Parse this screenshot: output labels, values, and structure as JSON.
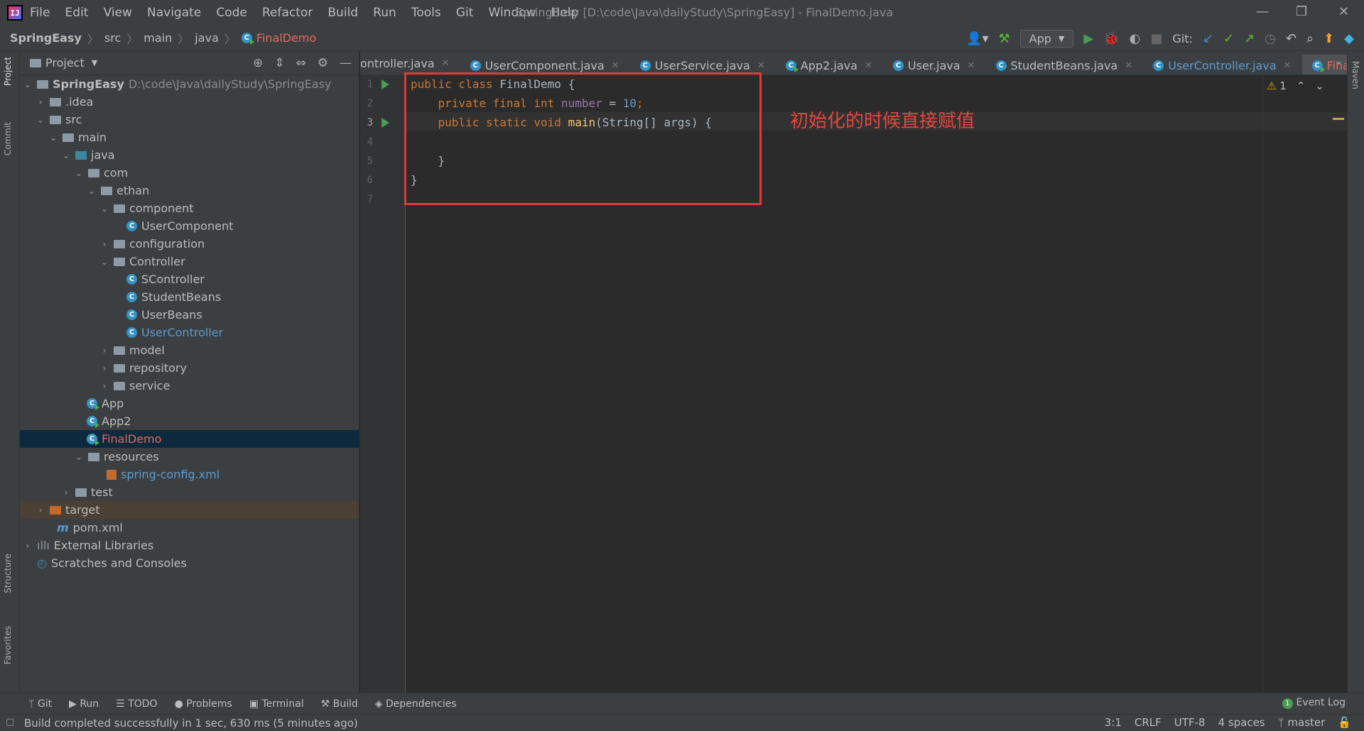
{
  "window": {
    "logo": "IJ",
    "menu": [
      "File",
      "Edit",
      "View",
      "Navigate",
      "Code",
      "Refactor",
      "Build",
      "Run",
      "Tools",
      "Git",
      "Window",
      "Help"
    ],
    "title": "SpringEasy [D:\\code\\Java\\dailyStudy\\SpringEasy] - FinalDemo.java"
  },
  "breadcrumb": [
    "SpringEasy",
    "src",
    "main",
    "java",
    "FinalDemo"
  ],
  "toolbar": {
    "run_config": "App",
    "git_label": "Git:"
  },
  "project_panel": {
    "title": "Project",
    "tree": [
      {
        "label": "SpringEasy",
        "path": "D:\\code\\Java\\dailyStudy\\SpringEasy"
      },
      {
        "label": ".idea"
      },
      {
        "label": "src"
      },
      {
        "label": "main"
      },
      {
        "label": "java"
      },
      {
        "label": "com"
      },
      {
        "label": "ethan"
      },
      {
        "label": "component"
      },
      {
        "label": "UserComponent"
      },
      {
        "label": "configuration"
      },
      {
        "label": "Controller"
      },
      {
        "label": "SController"
      },
      {
        "label": "StudentBeans"
      },
      {
        "label": "UserBeans"
      },
      {
        "label": "UserController"
      },
      {
        "label": "model"
      },
      {
        "label": "repository"
      },
      {
        "label": "service"
      },
      {
        "label": "App"
      },
      {
        "label": "App2"
      },
      {
        "label": "FinalDemo"
      },
      {
        "label": "resources"
      },
      {
        "label": "spring-config.xml"
      },
      {
        "label": "test"
      },
      {
        "label": "target"
      },
      {
        "label": "pom.xml"
      },
      {
        "label": "External Libraries"
      },
      {
        "label": "Scratches and Consoles"
      }
    ]
  },
  "left_strip": [
    "Project",
    "Commit",
    "Structure",
    "Favorites"
  ],
  "right_strip": [
    "Maven"
  ],
  "editor_tabs": [
    "ontroller.java",
    "UserComponent.java",
    "UserService.java",
    "App2.java",
    "User.java",
    "StudentBeans.java",
    "UserController.java",
    "FinalDemo.java"
  ],
  "editor": {
    "line_numbers": [
      "1",
      "2",
      "3",
      "4",
      "5",
      "6",
      "7"
    ],
    "lines": [
      [
        "public class ",
        "FinalDemo {"
      ],
      [
        "    private final int ",
        "number",
        " = ",
        "10",
        ";"
      ],
      [
        "    public static void ",
        "main",
        "(String[] args) {"
      ],
      [
        ""
      ],
      [
        "    }"
      ],
      [
        "}"
      ],
      [
        ""
      ]
    ],
    "warnings": "1"
  },
  "annotation": "初始化的时候直接赋值",
  "bottom_tabs": [
    "Git",
    "Run",
    "TODO",
    "Problems",
    "Terminal",
    "Build",
    "Dependencies"
  ],
  "event_log": {
    "count": "1",
    "label": "Event Log"
  },
  "status": {
    "message": "Build completed successfully in 1 sec, 630 ms (5 minutes ago)",
    "position": "3:1",
    "line_sep": "CRLF",
    "encoding": "UTF-8",
    "indent": "4 spaces",
    "branch": "master"
  },
  "colors": {
    "accent": "#4a88c7",
    "selected_file": "#e06c5f",
    "annotation": "#e03a3a"
  }
}
